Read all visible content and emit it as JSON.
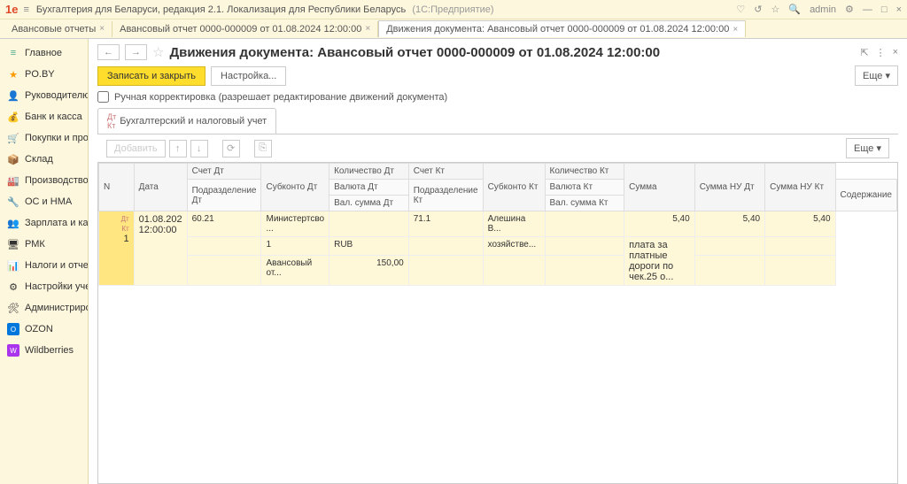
{
  "titlebar": {
    "logo": "1e",
    "title": "Бухгалтерия для Беларуси, редакция 2.1. Локализация для Республики Беларусь",
    "sub": "(1С:Предприятие)",
    "user": "admin"
  },
  "tabs": [
    {
      "label": "Авансовые отчеты"
    },
    {
      "label": "Авансовый отчет 0000-000009 от 01.08.2024 12:00:00"
    },
    {
      "label": "Движения документа: Авансовый отчет 0000-000009 от 01.08.2024 12:00:00"
    }
  ],
  "sidebar": [
    {
      "label": "Главное",
      "color": "#4a8"
    },
    {
      "label": "PO.BY",
      "color": "#f90"
    },
    {
      "label": "Руководителю",
      "color": "#888"
    },
    {
      "label": "Банк и касса",
      "color": "#888"
    },
    {
      "label": "Покупки и продажи",
      "color": "#888"
    },
    {
      "label": "Склад",
      "color": "#888"
    },
    {
      "label": "Производство",
      "color": "#888"
    },
    {
      "label": "ОС и НМА",
      "color": "#888"
    },
    {
      "label": "Зарплата и кадры",
      "color": "#888"
    },
    {
      "label": "РМК",
      "color": "#888"
    },
    {
      "label": "Налоги и отчетность",
      "color": "#888"
    },
    {
      "label": "Настройки учета",
      "color": "#888"
    },
    {
      "label": "Администрирование",
      "color": "#888"
    },
    {
      "label": "OZON",
      "color": "#07d"
    },
    {
      "label": "Wildberries",
      "color": "#a3e"
    }
  ],
  "page": {
    "title": "Движения документа: Авансовый отчет 0000-000009 от 01.08.2024 12:00:00",
    "btn_save": "Записать и закрыть",
    "btn_settings": "Настройка...",
    "more": "Еще",
    "check_label": "Ручная корректировка (разрешает редактирование движений документа)",
    "subtab": "Бухгалтерский и налоговый учет",
    "add_btn": "Добавить"
  },
  "grid": {
    "headers": {
      "n": "N",
      "date": "Дата",
      "acc_dt": "Счет Дт",
      "sub_dt": "Субконто Дт",
      "qty_dt": "Количество Дт",
      "acc_kt": "Счет Кт",
      "sub_kt": "Субконто Кт",
      "qty_kt": "Количество Кт",
      "amount": "Сумма",
      "amt_nu_dt": "Сумма НУ Дт",
      "amt_nu_kt": "Сумма НУ Кт",
      "subdiv_dt": "Подразделение Дт",
      "cur_dt": "Валюта Дт",
      "cur_amt_dt": "Вал. сумма Дт",
      "subdiv_kt": "Подразделение Кт",
      "cur_kt": "Валюта Кт",
      "cur_amt_kt": "Вал. сумма Кт",
      "content": "Содержание"
    },
    "row": {
      "n": "1",
      "date1": "01.08.202",
      "date2": "12:00:00",
      "acc_dt": "60.21",
      "sub_dt1": "Министертсво ...",
      "sub_dt2": "1",
      "sub_dt3": "Авансовый от...",
      "cur_dt": "RUB",
      "cur_amt_dt": "150,00",
      "acc_kt": "71.1",
      "sub_kt1": "Алешина В...",
      "sub_kt2": "хозяйстве...",
      "amount": "5,40",
      "content1": "плата за платные",
      "content2": "дороги  по чек.25 о...",
      "amt_nu_dt": "5,40",
      "amt_nu_kt": "5,40"
    }
  }
}
